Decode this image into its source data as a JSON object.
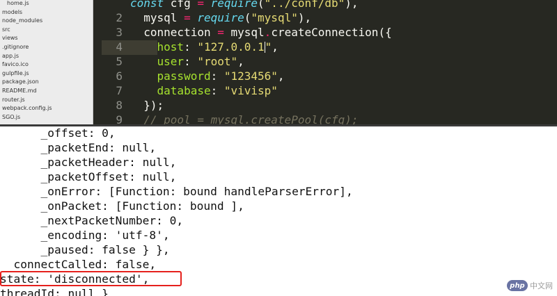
{
  "sidebar": {
    "items": [
      {
        "label": "home.js",
        "indent": true
      },
      {
        "label": "models",
        "indent": false
      },
      {
        "label": "node_modules",
        "indent": false
      },
      {
        "label": "src",
        "indent": false
      },
      {
        "label": "views",
        "indent": false
      },
      {
        "label": ".gitignore",
        "indent": false
      },
      {
        "label": "app.js",
        "indent": false
      },
      {
        "label": "favico.ico",
        "indent": false
      },
      {
        "label": "gulpfile.js",
        "indent": false
      },
      {
        "label": "package.json",
        "indent": false
      },
      {
        "label": "README.md",
        "indent": false
      },
      {
        "label": "router.js",
        "indent": false
      },
      {
        "label": "webpack.config.js",
        "indent": false
      },
      {
        "label": "SGO.js",
        "indent": false
      }
    ]
  },
  "editor": {
    "active_line": "4",
    "lines": [
      {
        "num": "",
        "tokens": [
          {
            "t": "const ",
            "c": "kw"
          },
          {
            "t": "cfg ",
            "c": "default"
          },
          {
            "t": "= ",
            "c": "op"
          },
          {
            "t": "require",
            "c": "kw"
          },
          {
            "t": "(",
            "c": "default"
          },
          {
            "t": "\"../conf/db\"",
            "c": "str"
          },
          {
            "t": "),",
            "c": "default"
          }
        ]
      },
      {
        "num": "2",
        "tokens": [
          {
            "t": "  mysql ",
            "c": "default"
          },
          {
            "t": "= ",
            "c": "op"
          },
          {
            "t": "require",
            "c": "kw"
          },
          {
            "t": "(",
            "c": "default"
          },
          {
            "t": "\"mysql\"",
            "c": "str"
          },
          {
            "t": "),",
            "c": "default"
          }
        ]
      },
      {
        "num": "3",
        "tokens": [
          {
            "t": "  connection ",
            "c": "default"
          },
          {
            "t": "= ",
            "c": "op"
          },
          {
            "t": "mysql",
            "c": "default"
          },
          {
            "t": ".",
            "c": "op"
          },
          {
            "t": "createConnection",
            "c": "default"
          },
          {
            "t": "({",
            "c": "default"
          }
        ]
      },
      {
        "num": "4",
        "tokens": [
          {
            "t": "    host",
            "c": "key"
          },
          {
            "t": ": ",
            "c": "default"
          },
          {
            "t": "\"127.0.0.1",
            "c": "str"
          },
          {
            "t": "|",
            "c": "cursor"
          },
          {
            "t": "\"",
            "c": "str"
          },
          {
            "t": ",",
            "c": "default"
          }
        ]
      },
      {
        "num": "5",
        "tokens": [
          {
            "t": "    user",
            "c": "key"
          },
          {
            "t": ": ",
            "c": "default"
          },
          {
            "t": "\"root\"",
            "c": "str"
          },
          {
            "t": ",",
            "c": "default"
          }
        ]
      },
      {
        "num": "6",
        "tokens": [
          {
            "t": "    password",
            "c": "key"
          },
          {
            "t": ": ",
            "c": "default"
          },
          {
            "t": "\"123456\"",
            "c": "str"
          },
          {
            "t": ",",
            "c": "default"
          }
        ]
      },
      {
        "num": "7",
        "tokens": [
          {
            "t": "    database",
            "c": "key"
          },
          {
            "t": ": ",
            "c": "default"
          },
          {
            "t": "\"vivisp\"",
            "c": "str"
          }
        ]
      },
      {
        "num": "8",
        "tokens": [
          {
            "t": "  });",
            "c": "default"
          }
        ]
      },
      {
        "num": "9",
        "tokens": [
          {
            "t": "  // pool = mysql.createPool(cfg);",
            "c": "cm"
          }
        ]
      }
    ]
  },
  "terminal": {
    "lines": [
      "      _offset: 0,",
      "      _packetEnd: null,",
      "      _packetHeader: null,",
      "      _packetOffset: null,",
      "      _onError: [Function: bound handleParserError],",
      "      _onPacket: [Function: bound ],",
      "      _nextPacketNumber: 0,",
      "      _encoding: 'utf-8',",
      "      _paused: false } },",
      "  connectCalled: false,",
      "state: 'disconnected',",
      "threadId: null }"
    ],
    "highlighted_line": "state: 'disconnected',"
  },
  "watermark": {
    "logo": "php",
    "text": "中文网"
  },
  "colors": {
    "editor_bg": "#272822",
    "highlight_box": "#e5201c"
  }
}
